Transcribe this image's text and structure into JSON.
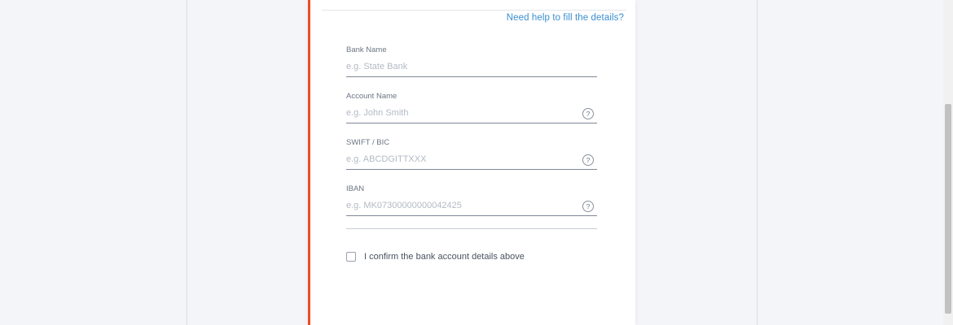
{
  "help_link": "Need help to fill the details?",
  "form": {
    "fields": [
      {
        "label": "Bank Name",
        "placeholder": "e.g. State Bank",
        "has_help": false
      },
      {
        "label": "Account Name",
        "placeholder": "e.g. John Smith",
        "has_help": true
      },
      {
        "label": "SWIFT / BIC",
        "placeholder": "e.g. ABCDGITTXXX",
        "has_help": true
      },
      {
        "label": "IBAN",
        "placeholder": "e.g. MK07300000000042425",
        "has_help": true
      }
    ],
    "help_icon_glyph": "?"
  },
  "confirm": {
    "label": "I confirm the bank account details above",
    "checked": false
  },
  "colors": {
    "accent_border": "#f04b23",
    "link": "#3a8fd1",
    "background": "#f3f5f8"
  }
}
